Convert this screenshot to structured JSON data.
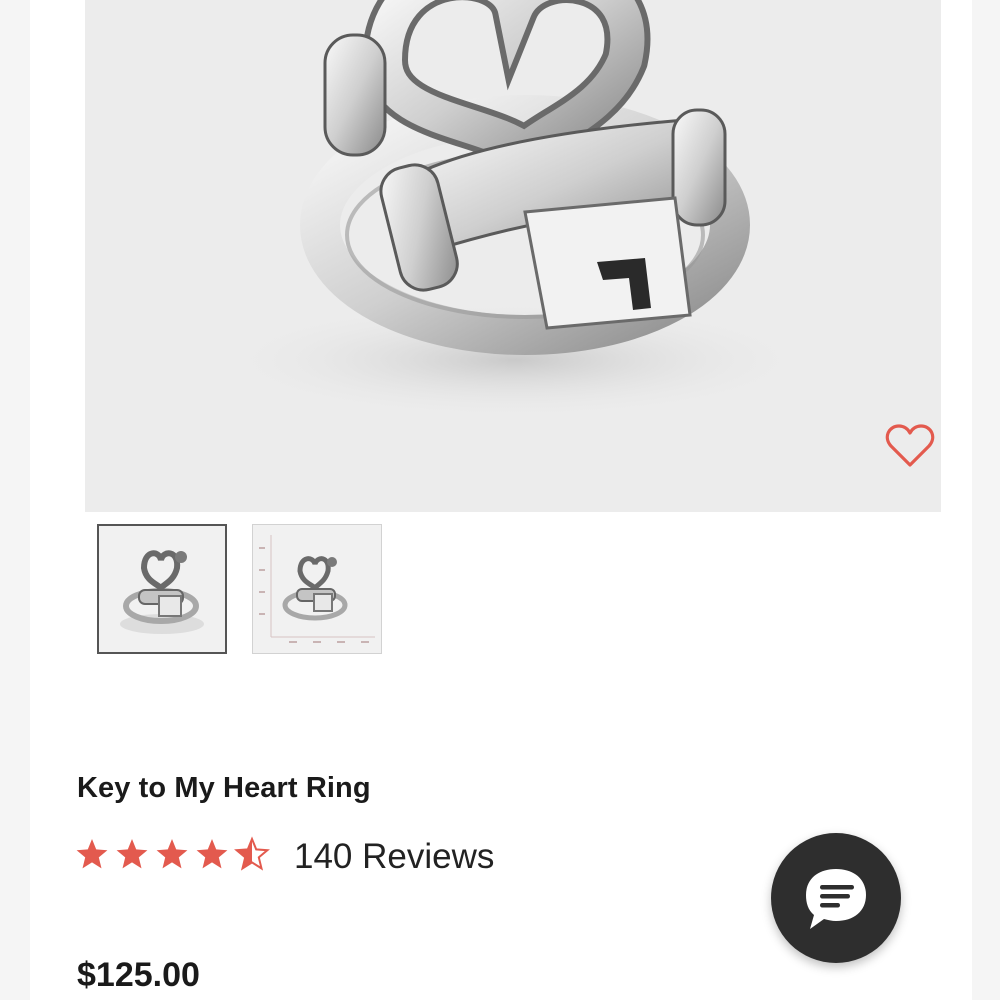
{
  "product": {
    "name": "Key to My Heart Ring",
    "rating": 4.5,
    "rating_max": 5,
    "reviews_label": "140 Reviews",
    "price": "$125.00",
    "images_count": 2,
    "selected_image": 1
  },
  "colors": {
    "accent": "#e35a4e",
    "chat_bg": "#2e2e2e",
    "hero_bg": "#ececec"
  },
  "icons": {
    "wishlist": "heart-outline-icon",
    "chat": "chat-bubble-icon",
    "rating": "star-icon"
  }
}
